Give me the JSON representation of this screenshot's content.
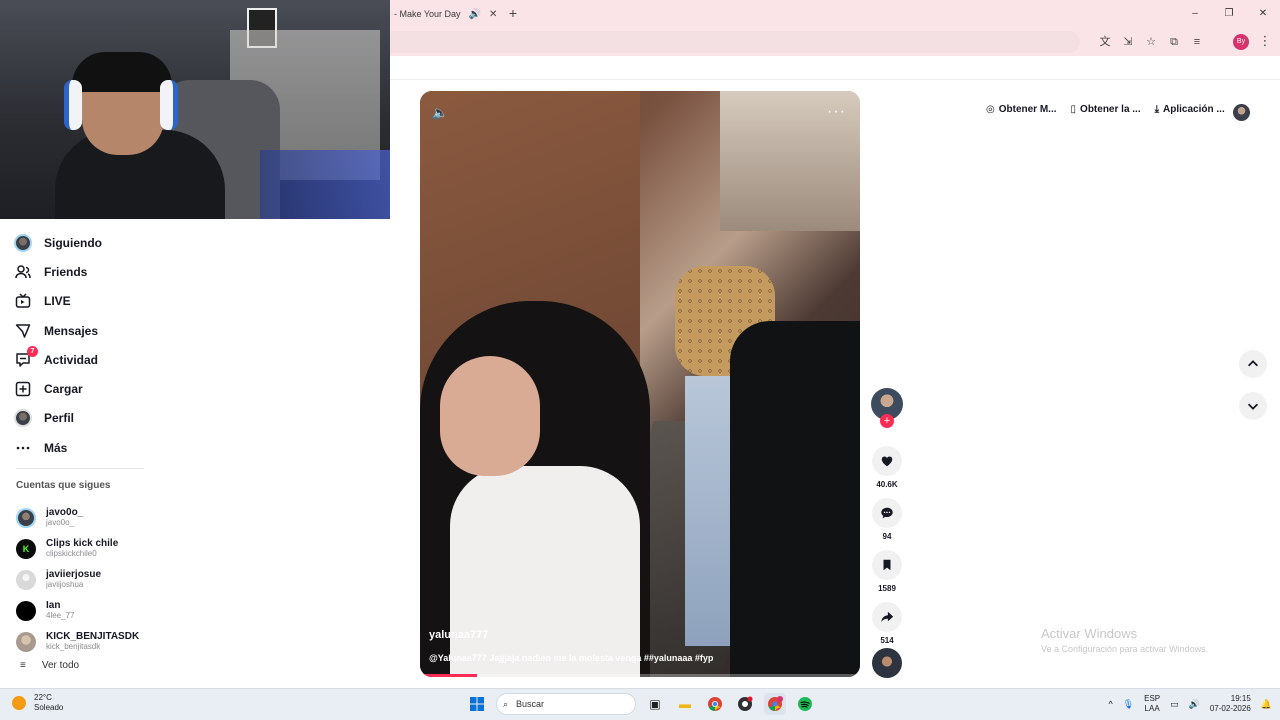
{
  "browser": {
    "tab_title": "- Make Your Day",
    "tab_audio_icon": "speaker-icon",
    "tab_close_icon": "close-icon",
    "new_tab_label": "+",
    "window_controls": [
      "–",
      "❐",
      "✕"
    ],
    "profile_initials": "By",
    "accent": "#fbe4e8"
  },
  "sidebar": {
    "nav": [
      {
        "label": "Siguiendo",
        "icon": "avatar-icon"
      },
      {
        "label": "Friends",
        "icon": "friends-icon"
      },
      {
        "label": "LIVE",
        "icon": "live-icon"
      },
      {
        "label": "Mensajes",
        "icon": "messages-icon"
      },
      {
        "label": "Actividad",
        "icon": "activity-icon",
        "badge": "7"
      },
      {
        "label": "Cargar",
        "icon": "upload-icon"
      },
      {
        "label": "Perfil",
        "icon": "profile-avatar-icon"
      },
      {
        "label": "Más",
        "icon": "more-icon"
      }
    ],
    "following_title": "Cuentas que sigues",
    "following": [
      {
        "name": "javo0o_",
        "handle": "javo0o_",
        "avatar_color": "#3a3f4a"
      },
      {
        "name": "Clips kick chile",
        "handle": "clipskickchile0",
        "avatar_color": "#0b0b0b",
        "avatar_text": "K"
      },
      {
        "name": "javiierjosue",
        "handle": "javiijoshua",
        "avatar_color": "#d9d9d9"
      },
      {
        "name": "Ian",
        "handle": "4lee_77",
        "avatar_color": "#000000"
      },
      {
        "name": "KICK_BENJITASDK",
        "handle": "kick_benjitasdk",
        "avatar_color": "#a89a8e"
      }
    ],
    "see_all": "Ver todo"
  },
  "video": {
    "author": "yalunaa777",
    "caption": "@Yalunaa777 Jajjjaja nadien me la molesta venga ##yalunaaa #fyp",
    "more_label": "···",
    "progress": 0.13
  },
  "actions": {
    "likes": "40.6K",
    "comments": "94",
    "saves": "1589",
    "shares": "514",
    "follow_plus": "+"
  },
  "top_links": [
    {
      "label": "Obtener M...",
      "icon": "coin-icon"
    },
    {
      "label": "Obtener la ...",
      "icon": "phone-icon"
    },
    {
      "label": "Aplicación ...",
      "icon": "download-icon"
    }
  ],
  "watermark": {
    "title": "Activar Windows",
    "subtitle": "Ve a Configuración para activar Windows."
  },
  "taskbar": {
    "weather_temp": "22°C",
    "weather_desc": "Soleado",
    "search_placeholder": "Buscar",
    "lang_top": "ESP",
    "lang_bottom": "LAA",
    "time": "19:15",
    "date": "07-02-2026",
    "tray_chevron": "^"
  }
}
